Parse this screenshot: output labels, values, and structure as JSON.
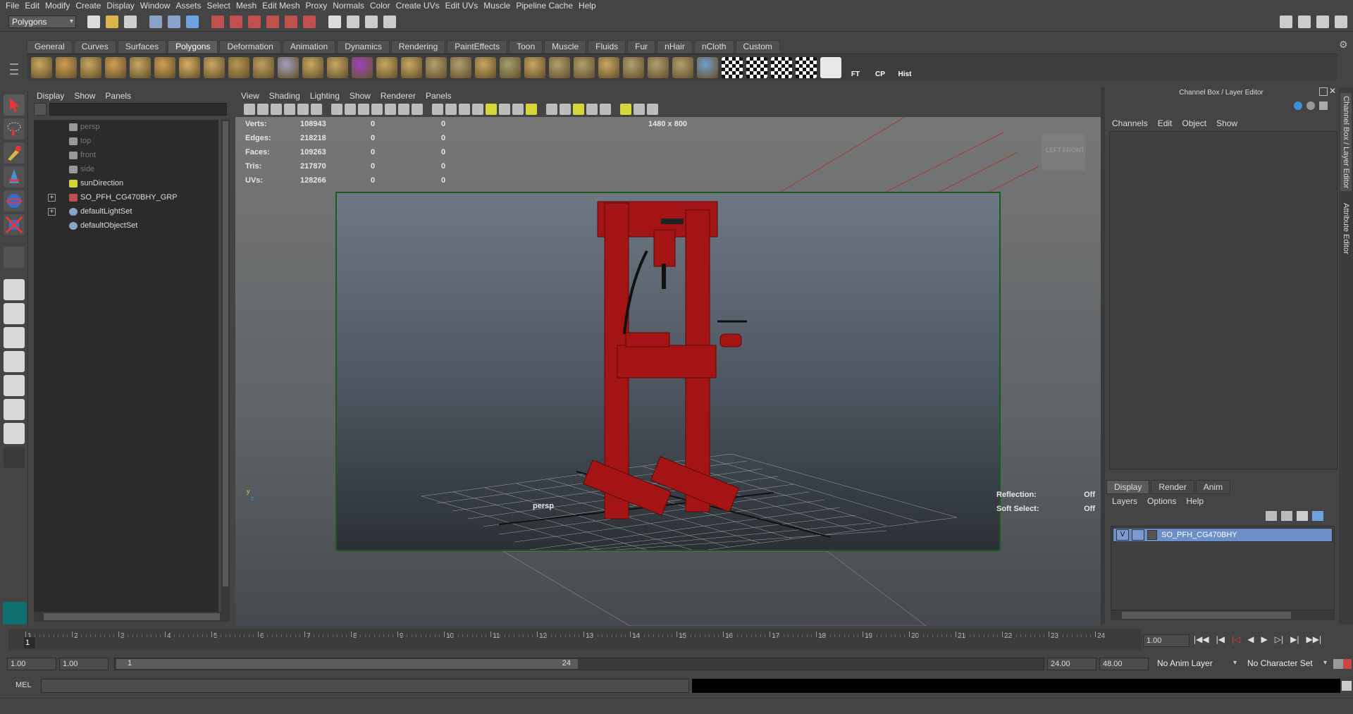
{
  "menubar": [
    "File",
    "Edit",
    "Modify",
    "Create",
    "Display",
    "Window",
    "Assets",
    "Select",
    "Mesh",
    "Edit Mesh",
    "Proxy",
    "Normals",
    "Color",
    "Create UVs",
    "Edit UVs",
    "Muscle",
    "Pipeline Cache",
    "Help"
  ],
  "statusline": {
    "menu_set": "Polygons"
  },
  "shelf": {
    "tabs": [
      "General",
      "Curves",
      "Surfaces",
      "Polygons",
      "Deformation",
      "Animation",
      "Dynamics",
      "Rendering",
      "PaintEffects",
      "Toon",
      "Muscle",
      "Fluids",
      "Fur",
      "nHair",
      "nCloth",
      "Custom"
    ],
    "active_tab": "Polygons",
    "text_buttons": [
      "FT",
      "CP",
      "Hist"
    ]
  },
  "outliner": {
    "menu": [
      "Display",
      "Show",
      "Panels"
    ],
    "items": [
      {
        "label": "persp",
        "type": "camera",
        "dim": true,
        "expand": false
      },
      {
        "label": "top",
        "type": "camera",
        "dim": true,
        "expand": false
      },
      {
        "label": "front",
        "type": "camera",
        "dim": true,
        "expand": false
      },
      {
        "label": "side",
        "type": "camera",
        "dim": true,
        "expand": false
      },
      {
        "label": "sunDirection",
        "type": "light",
        "dim": false,
        "expand": false
      },
      {
        "label": "SO_PFH_CG470BHY_GRP",
        "type": "group",
        "dim": false,
        "expand": true
      },
      {
        "label": "defaultLightSet",
        "type": "set",
        "dim": false,
        "expand": true
      },
      {
        "label": "defaultObjectSet",
        "type": "set",
        "dim": false,
        "expand": false
      }
    ]
  },
  "viewport": {
    "menu": [
      "View",
      "Shading",
      "Lighting",
      "Show",
      "Renderer",
      "Panels"
    ],
    "resolution": "1480 x 800",
    "camera_name": "persp",
    "hud": [
      {
        "label": "Verts:",
        "v1": "108943",
        "v2": "0",
        "v3": "0"
      },
      {
        "label": "Edges:",
        "v1": "218218",
        "v2": "0",
        "v3": "0"
      },
      {
        "label": "Faces:",
        "v1": "109263",
        "v2": "0",
        "v3": "0"
      },
      {
        "label": "Tris:",
        "v1": "217870",
        "v2": "0",
        "v3": "0"
      },
      {
        "label": "UVs:",
        "v1": "128266",
        "v2": "0",
        "v3": "0"
      }
    ],
    "reflection_label": "Reflection:",
    "reflection_value": "Off",
    "soft_select_label": "Soft Select:",
    "soft_select_value": "Off",
    "viewcube": [
      "LEFT",
      "FRONT"
    ]
  },
  "channel_box": {
    "title": "Channel Box / Layer Editor",
    "menu": [
      "Channels",
      "Edit",
      "Object",
      "Show"
    ],
    "side_tabs": [
      "Channel Box / Layer Editor",
      "Attribute Editor"
    ]
  },
  "layer_editor": {
    "tabs": [
      "Display",
      "Render",
      "Anim"
    ],
    "active_tab": "Display",
    "menu": [
      "Layers",
      "Options",
      "Help"
    ],
    "layers": [
      {
        "visible": "V",
        "name": "SO_PFH_CG470BHY"
      }
    ]
  },
  "timeline": {
    "ticks": [
      "1",
      "2",
      "3",
      "4",
      "5",
      "6",
      "7",
      "8",
      "9",
      "10",
      "11",
      "12",
      "13",
      "14",
      "15",
      "16",
      "17",
      "18",
      "19",
      "20",
      "21",
      "22",
      "23",
      "24"
    ],
    "current_frame_display": "1",
    "current_time": "1.00"
  },
  "range": {
    "start": "1.00",
    "inner_start": "1.00",
    "slider_start": "1",
    "slider_end": "24",
    "end": "24.00",
    "outer_end": "48.00",
    "anim_layer": "No Anim Layer",
    "character_set": "No Character Set"
  },
  "command_line": {
    "label": "MEL"
  },
  "colors": {
    "bg": "#444444",
    "panel_dark": "#2b2b2b",
    "accent_blue": "#5a7fae",
    "model_red": "#b01212",
    "gate_green": "#1d5a1d"
  }
}
